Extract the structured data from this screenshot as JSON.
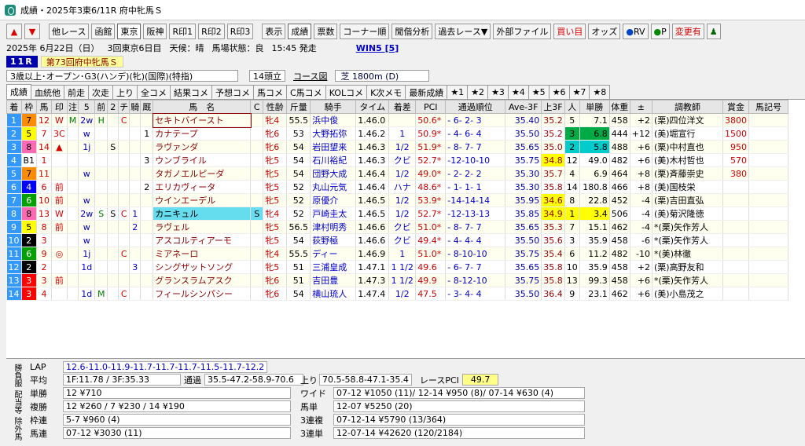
{
  "window": {
    "title": "成績・2025年3東6/11R 府中牝馬Ｓ"
  },
  "toolbar": [
    "他レース",
    "函館",
    "東京",
    "阪神",
    "R印1",
    "R印2",
    "R印3",
    "表示",
    "成績",
    "票数",
    "コーナー順",
    "閒偕分析",
    "過去レース▼",
    "外部ファイル",
    "買い目",
    "オッズ",
    "RV",
    "P",
    "変更有"
  ],
  "toolbar_selected": [
    "東京",
    "成績"
  ],
  "info": {
    "date": "2025年 6月22日（日）",
    "kai": "3回東京6日目",
    "weather_label": "天候：",
    "weather": "晴",
    "baba_label": "馬場状態：",
    "baba": "良",
    "time": "15:45 発走",
    "win5": "WIN5 [5]"
  },
  "race": {
    "num": "11R",
    "name": "第73回府中牝馬Ｓ",
    "cond": "3歳以上･オープン･G3(ハンデ)(牝)(国際)(特指)",
    "heads": "14頭立",
    "course_label": "コース図",
    "course": "芝 1800m (D)"
  },
  "tabs": [
    "成績",
    "血統他",
    "前走",
    "次走",
    "上り",
    "全コメ",
    "結果コメ",
    "予想コメ",
    "馬コメ",
    "C馬コメ",
    "KOLコメ",
    "K次メモ",
    "最新成績",
    "★1",
    "★2",
    "★3",
    "★4",
    "★5",
    "★6",
    "★7",
    "★8"
  ],
  "columns": [
    "着",
    "枠",
    "馬",
    "印",
    "注",
    "5",
    "前",
    "2",
    "チ",
    "騎",
    "厩",
    "馬　名",
    "C",
    "性齢",
    "斤量",
    "騎手",
    "タイム",
    "着差",
    "PCI",
    "通過順位",
    "Ave-3F",
    "上3F",
    "人",
    "単勝",
    "体重",
    "±",
    "調教師",
    "賞金",
    "馬記号"
  ],
  "rows": [
    [
      "1",
      "7",
      "12",
      "W",
      "M",
      "2w",
      "H",
      "",
      "C",
      "",
      "",
      "セキトバイースト",
      "",
      "牝4",
      "55.5",
      "浜中俊",
      "1.46.0",
      "",
      "50.6*",
      "- 6- 2- 3",
      "35.40",
      "35.2",
      "5",
      "7.1",
      "458",
      "+2",
      "(栗)四位洋文",
      "3800",
      ""
    ],
    [
      "2",
      "5",
      "7",
      "3C",
      "",
      "w",
      "",
      "",
      "",
      "",
      "1",
      "カナテープ",
      "",
      "牝6",
      "53",
      "大野拓弥",
      "1.46.2",
      "1",
      "50.9*",
      "- 4- 6- 4",
      "35.50",
      "35.2",
      "3",
      "6.8",
      "444",
      "+12",
      "(美)堀宣行",
      "1500",
      ""
    ],
    [
      "3",
      "8",
      "14",
      "▲",
      "",
      "1j",
      "",
      "S",
      "",
      "",
      "",
      "ラヴァンダ",
      "",
      "牝6",
      "54",
      "岩田望来",
      "1.46.3",
      "1/2",
      "51.9*",
      "- 8- 7- 7",
      "35.65",
      "35.0",
      "2",
      "5.8",
      "488",
      "+6",
      "(栗)中村直也",
      "950",
      ""
    ],
    [
      "4",
      "B1",
      "1",
      "",
      "",
      "",
      "",
      "",
      "",
      "",
      "3",
      "ウンブライル",
      "",
      "牝5",
      "54",
      "石川裕紀",
      "1.46.3",
      "クビ",
      "52.7*",
      "-12-10-10",
      "35.75",
      "34.8",
      "12",
      "49.0",
      "482",
      "+6",
      "(美)木村哲也",
      "570",
      ""
    ],
    [
      "5",
      "7",
      "11",
      "",
      "",
      "w",
      "",
      "",
      "",
      "",
      "",
      "タガノエルピーダ",
      "",
      "牝5",
      "54",
      "団野大成",
      "1.46.4",
      "1/2",
      "49.0*",
      "- 2- 2- 2",
      "35.30",
      "35.7",
      "4",
      "6.9",
      "464",
      "+8",
      "(栗)斉藤崇史",
      "380",
      ""
    ],
    [
      "6",
      "4",
      "6",
      "前",
      "",
      "",
      "",
      "",
      "",
      "",
      "2",
      "エリカヴィータ",
      "",
      "牝5",
      "52",
      "丸山元気",
      "1.46.4",
      "ハナ",
      "48.6*",
      "- 1- 1- 1",
      "35.30",
      "35.8",
      "14",
      "180.8",
      "466",
      "+8",
      "(美)国枝栄",
      "",
      ""
    ],
    [
      "7",
      "6",
      "10",
      "前",
      "",
      "w",
      "",
      "",
      "",
      "",
      "",
      "ウインエーデル",
      "",
      "牝5",
      "52",
      "原優介",
      "1.46.5",
      "1/2",
      "53.9*",
      "-14-14-14",
      "35.95",
      "34.6",
      "8",
      "22.8",
      "452",
      "-4",
      "(栗)吉田直弘",
      "",
      ""
    ],
    [
      "8",
      "8",
      "13",
      "W",
      "",
      "2w",
      "S",
      "S",
      "C",
      "1",
      "",
      "カニキュル",
      "S",
      "牝4",
      "52",
      "戸崎圭太",
      "1.46.5",
      "1/2",
      "52.7*",
      "-12-13-13",
      "35.85",
      "34.9",
      "1",
      "3.4",
      "506",
      "-4",
      "(美)菊沢隆徳",
      "",
      ""
    ],
    [
      "9",
      "5",
      "8",
      "前",
      "",
      "w",
      "",
      "",
      "",
      "2",
      "",
      "ラヴェル",
      "",
      "牝5",
      "56.5",
      "津村明秀",
      "1.46.6",
      "クビ",
      "51.0*",
      "- 8- 7- 7",
      "35.65",
      "35.3",
      "7",
      "15.1",
      "462",
      "-4",
      "*(栗)矢作芳人",
      "",
      ""
    ],
    [
      "10",
      "2",
      "3",
      "",
      "",
      "w",
      "",
      "",
      "",
      "",
      "",
      "アスコルティアーモ",
      "",
      "牝5",
      "54",
      "荻野極",
      "1.46.6",
      "クビ",
      "49.4*",
      "- 4- 4- 4",
      "35.50",
      "35.6",
      "3",
      "35.9",
      "458",
      "-6",
      "*(栗)矢作芳人",
      "",
      ""
    ],
    [
      "11",
      "6",
      "9",
      "◎",
      "",
      "1j",
      "",
      "",
      "C",
      "",
      "",
      "ミアネーロ",
      "",
      "牝4",
      "55.5",
      "ディー",
      "1.46.9",
      "1",
      "51.0*",
      "- 8-10-10",
      "35.75",
      "35.4",
      "6",
      "11.2",
      "482",
      "-10",
      "*(美)林徹",
      "",
      ""
    ],
    [
      "12",
      "2",
      "2",
      "",
      "",
      "1d",
      "",
      "",
      "",
      "3",
      "",
      "シングザットソング",
      "",
      "牝5",
      "51",
      "三浦皇成",
      "1.47.1",
      "1 1/2",
      "49.6",
      "- 6- 7- 7",
      "35.65",
      "35.8",
      "10",
      "35.9",
      "458",
      "+2",
      "(栗)高野友和",
      "",
      ""
    ],
    [
      "13",
      "3",
      "3",
      "前",
      "",
      "",
      "",
      "",
      "",
      "",
      "",
      "グランスラムアスク",
      "",
      "牝6",
      "51",
      "吉田豊",
      "1.47.3",
      "1 1/2",
      "49.9",
      "- 8-12-10",
      "35.75",
      "35.8",
      "13",
      "99.3",
      "458",
      "+6",
      "*(栗)矢作芳人",
      "",
      ""
    ],
    [
      "14",
      "3",
      "4",
      "",
      "",
      "1d",
      "M",
      "",
      "C",
      "",
      "",
      "フィールシンパシー",
      "",
      "牝6",
      "54",
      "横山琉人",
      "1.47.4",
      "1/2",
      "47.5",
      "- 3- 4- 4",
      "35.50",
      "36.4",
      "9",
      "23.1",
      "462",
      "+6",
      "(美)小島茂之",
      "",
      ""
    ]
  ],
  "bottom": {
    "side_tabs": [
      "勝負服",
      "配当等",
      "除外馬"
    ],
    "lap_label": "LAP",
    "lap": "12.6-11.0-11.9-11.7-11.7-11.7-11.5-11.7-12.2",
    "avg_label": "平均",
    "avg": "1F:11.78 / 3F:35.33",
    "tsuka_label": "通過",
    "tsuka": "35.5-47.2-58.9-70.6",
    "agari_label": "上り",
    "agari": "70.5-58.8-47.1-35.4",
    "pci_label": "レースPCI",
    "pci": "49.7",
    "tansho_label": "単勝",
    "tansho": "12 ¥710",
    "fukusho_label": "複勝",
    "fukusho": "12 ¥260 / 7 ¥230 / 14 ¥190",
    "wakuren_label": "枠連",
    "wakuren": "5-7 ¥960 (4)",
    "umaren_label": "馬連",
    "umaren": "07-12 ¥3030 (11)",
    "wide_label": "ワイド",
    "wide": "07-12 ¥1050 (11)/ 12-14 ¥950 (8)/ 07-14 ¥630 (4)",
    "umatan_label": "馬単",
    "umatan": "12-07 ¥5250 (20)",
    "sanrenpuku_label": "3連複",
    "sanrenpuku": "07-12-14 ¥5790 (13/364)",
    "sanrentan_label": "3連単",
    "sanrentan": "12-07-14 ¥42620 (120/2184)"
  },
  "colors": {
    "waku": [
      "#ffffff",
      "#000000",
      "#ff0000",
      "#0000ff",
      "#ffff00",
      "#00a000",
      "#ff8c00",
      "#ff69b4"
    ],
    "accent": "#3399ff",
    "pci_bg": "#ffff88"
  }
}
